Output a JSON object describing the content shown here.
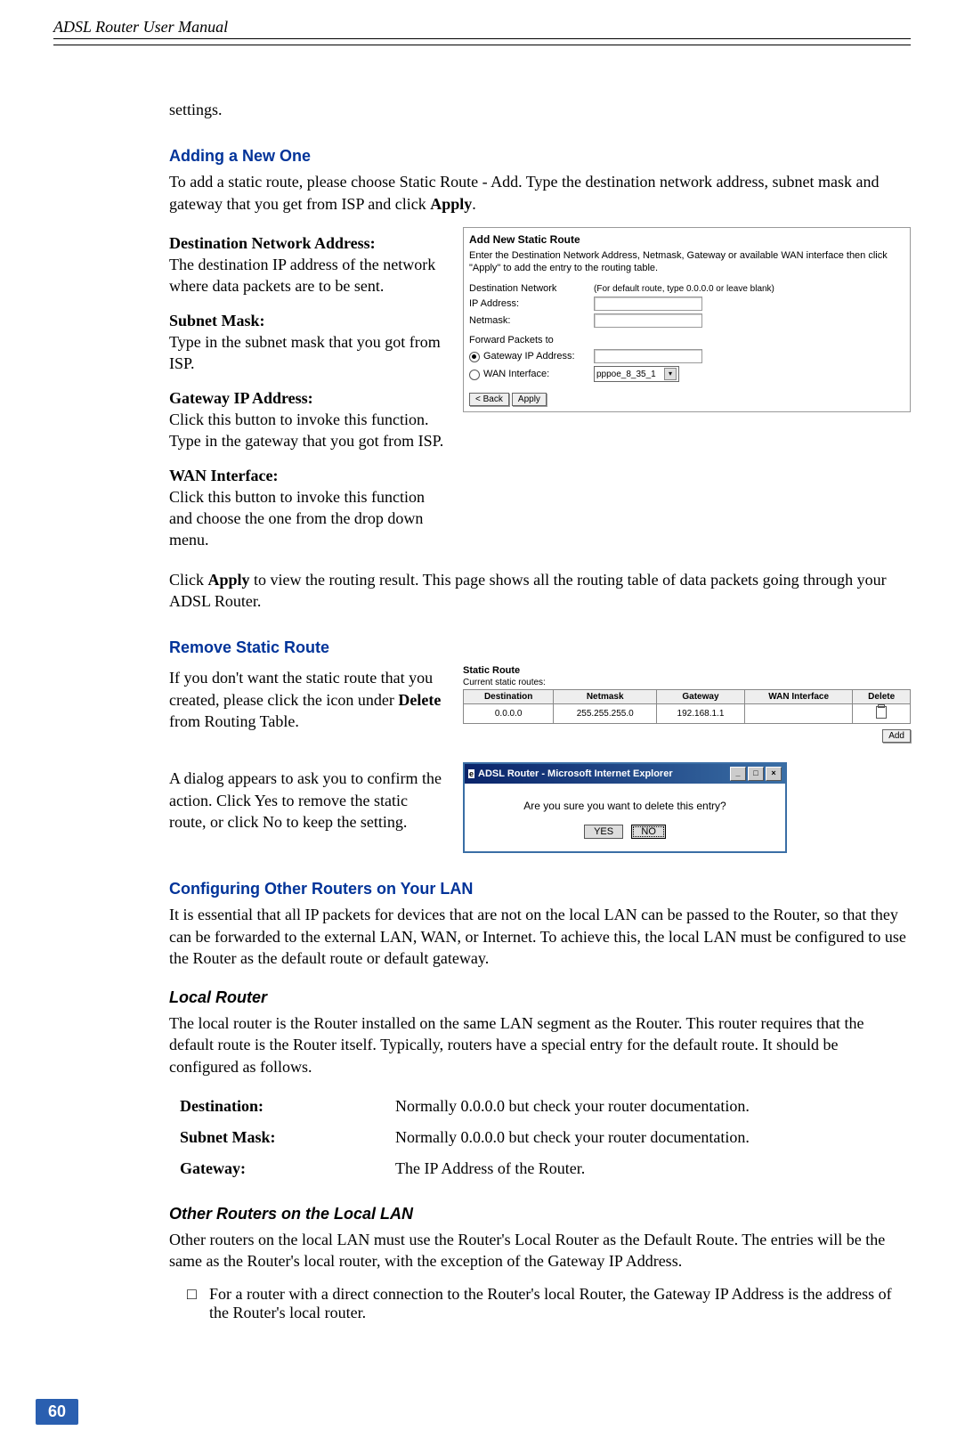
{
  "header": {
    "title": "ADSL Router User Manual"
  },
  "intro": "settings.",
  "sections": {
    "adding": {
      "heading": "Adding a New One",
      "para": "To add a static route, please choose Static Route - Add. Type the destination network address, subnet mask and gateway that you get from ISP and click ",
      "para_bold": "Apply",
      "para_end": ".",
      "defs": {
        "dna_title": "Destination Network Address:",
        "dna_text": "The destination IP address of the network where data packets are to be sent.",
        "sm_title": "Subnet Mask:",
        "sm_text": "Type in the subnet mask that you got from ISP.",
        "gip_title": "Gateway IP Address:",
        "gip_text": "Click this button to invoke this function. Type in the gateway that you got from ISP.",
        "wan_title": "WAN Interface:",
        "wan_text": "Click this button to invoke this function and choose the one from the drop down menu."
      },
      "screenshot": {
        "title": "Add New Static Route",
        "desc": "Enter the Destination Network Address, Netmask, Gateway or available WAN interface then click \"Apply\" to add the entry to the routing table.",
        "dest_label": "Destination Network",
        "dest_hint": "(For default route, type 0.0.0.0 or leave blank)",
        "ip_label": "IP Address:",
        "netmask_label": "Netmask:",
        "forward_label": "Forward Packets to",
        "gateway_radio": "Gateway IP Address:",
        "wan_radio": "WAN Interface:",
        "wan_value": "pppoe_8_35_1",
        "back_btn": "< Back",
        "apply_btn": "Apply"
      },
      "after": "Click ",
      "after_bold": "Apply",
      "after_end": " to view the routing result. This page shows all the routing table of data packets going through your ADSL Router."
    },
    "remove": {
      "heading": "Remove Static Route",
      "para1": "If you don't want the static route that you created, please click the icon under ",
      "para1_bold": "Delete",
      "para1_end": " from Routing Table.",
      "table": {
        "title": "Static Route",
        "subtitle": "Current static routes:",
        "headers": [
          "Destination",
          "Netmask",
          "Gateway",
          "WAN Interface",
          "Delete"
        ],
        "row": [
          "0.0.0.0",
          "255.255.255.0",
          "192.168.1.1",
          "",
          ""
        ],
        "add_btn": "Add"
      },
      "para2": "A dialog appears to ask you to confirm the action. Click Yes to remove the static route, or click No to keep the setting.",
      "dialog": {
        "title": "ADSL Router - Microsoft Internet Explorer",
        "question": "Are you sure you want to delete this entry?",
        "yes": "YES",
        "no": "NO"
      }
    },
    "configuring": {
      "heading": "Configuring Other Routers on Your LAN",
      "para": "It is essential that all IP packets for devices that are not on the local LAN can be passed to the Router, so that they can be forwarded to the external LAN, WAN, or Internet. To achieve this, the local LAN must be configured to use the Router as the default route or default gateway."
    },
    "local_router": {
      "heading": "Local Router",
      "para": "The local router is the Router installed on the same LAN segment as the Router. This router requires that the default route is the Router itself. Typically, routers have a special entry for the default route. It should be configured as follows.",
      "table": {
        "dest_label": "Destination:",
        "dest_val": "Normally 0.0.0.0 but check your router documentation.",
        "subnet_label": "Subnet Mask:",
        "subnet_val": "Normally 0.0.0.0 but check your router documentation.",
        "gateway_label": "Gateway:",
        "gateway_val": "The IP Address of the Router."
      }
    },
    "other_routers": {
      "heading": "Other Routers on the Local LAN",
      "para": "Other routers on the local LAN must use the Router's Local Router as the Default Route. The entries will be the same as the Router's local router, with the exception of the Gateway IP Address.",
      "bullet_marker": "□",
      "bullet_text": "For a router with a direct connection to the Router's local Router, the Gateway IP Address is the address of the Router's local router."
    }
  },
  "page_number": "60"
}
